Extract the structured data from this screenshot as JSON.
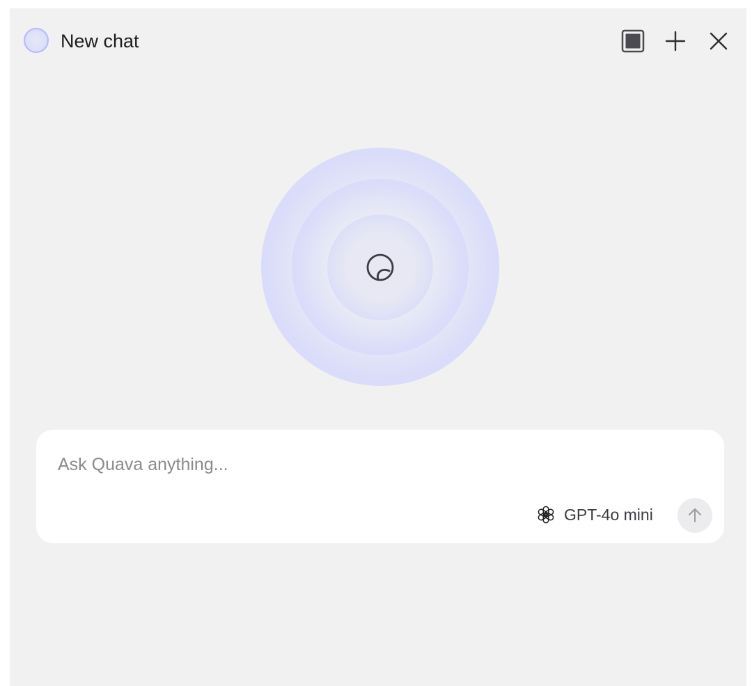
{
  "window": {
    "title": "New chat"
  },
  "header": {
    "icons": {
      "avatar": "chat-avatar-icon",
      "layout": "sidebar-toggle-icon",
      "new_chat": "plus-icon",
      "close": "close-icon"
    }
  },
  "hero": {
    "icon": "quava-logo-icon",
    "ring_color": "#b1b8fc"
  },
  "composer": {
    "input_value": "",
    "placeholder": "Ask Quava anything...",
    "model": {
      "icon": "openai-logo-icon",
      "label": "GPT-4o mini"
    },
    "send_icon": "arrow-up-icon"
  },
  "colors": {
    "panel_bg": "#f1f1f1",
    "composer_bg": "#ffffff",
    "accent": "#b1b8fc",
    "text": "#1c1c1f",
    "placeholder": "#8a8a90"
  }
}
